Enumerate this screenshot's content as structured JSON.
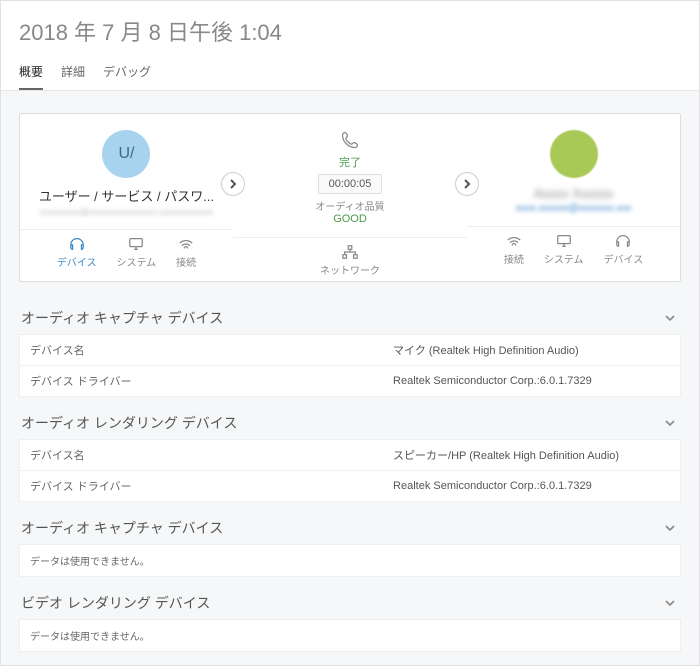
{
  "title": "2018 年 7 月 8 日午後 1:04",
  "tabs": {
    "overview": "概要",
    "details": "詳細",
    "debug": "デバッグ"
  },
  "card": {
    "left": {
      "avatar_initials": "U/",
      "name": "ユーザー / サービス / パスワ...",
      "email": "xxxxxxxxx@xxxxxxxxxxxxxxx.xxxxxxxxxxxx"
    },
    "mid": {
      "status": "完了",
      "duration": "00:00:05",
      "quality_label": "オーディオ品質",
      "quality_value": "GOOD"
    },
    "right": {
      "name": "Axxxx Xxxxxx",
      "email": "xxxx.xxxxxx@xxxxxxx.xxx"
    },
    "subtabs_left": {
      "device": "デバイス",
      "system": "システム",
      "connection": "接続"
    },
    "subtabs_mid": {
      "network": "ネットワーク"
    },
    "subtabs_right": {
      "connection": "接続",
      "system": "システム",
      "device": "デバイス"
    }
  },
  "sections": {
    "audio_capture": {
      "title": "オーディオ キャプチャ デバイス",
      "rows": [
        {
          "k": "デバイス名",
          "v": "マイク (Realtek High Definition Audio)"
        },
        {
          "k": "デバイス ドライバー",
          "v": "Realtek Semiconductor Corp.:6.0.1.7329"
        }
      ]
    },
    "audio_render": {
      "title": "オーディオ レンダリング デバイス",
      "rows": [
        {
          "k": "デバイス名",
          "v": "スピーカー/HP (Realtek High Definition Audio)"
        },
        {
          "k": "デバイス ドライバー",
          "v": "Realtek Semiconductor Corp.:6.0.1.7329"
        }
      ]
    },
    "audio_capture2": {
      "title": "オーディオ キャプチャ デバイス",
      "nodata": "データは使用できません。"
    },
    "video_render": {
      "title": "ビデオ レンダリング デバイス",
      "nodata": "データは使用できません。"
    }
  }
}
